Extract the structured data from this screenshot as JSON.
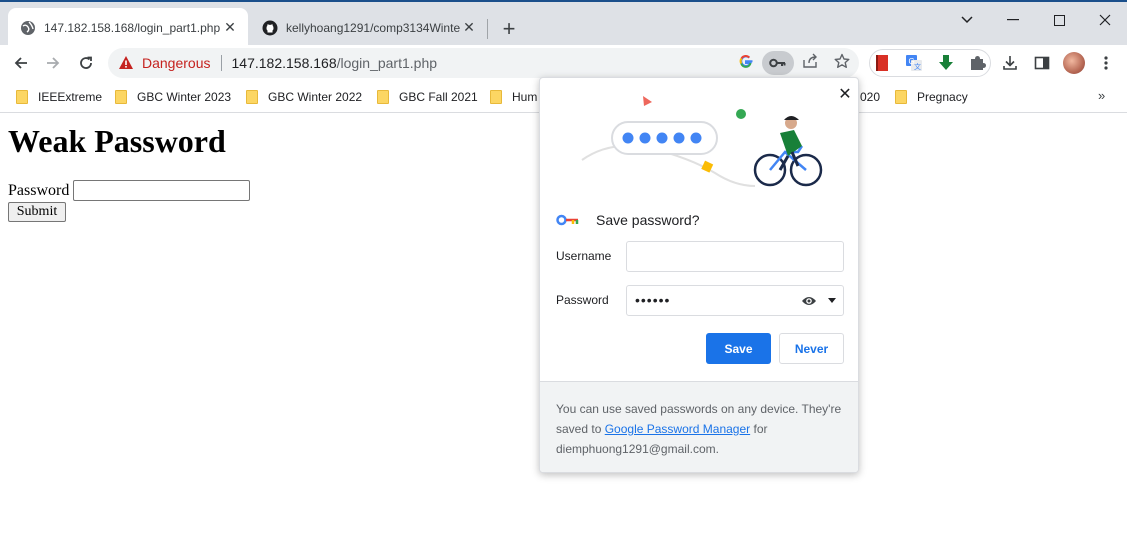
{
  "tabs": [
    {
      "title": "147.182.158.168/login_part1.php",
      "active": true
    },
    {
      "title": "kellyhoang1291/comp3134Winte",
      "active": false
    }
  ],
  "omnibox": {
    "security_label": "Dangerous",
    "url_host": "147.182.158.168",
    "url_path": "/login_part1.php"
  },
  "bookmarks": [
    {
      "label": "IEEExtreme"
    },
    {
      "label": "GBC Winter 2023"
    },
    {
      "label": "GBC Winter 2022"
    },
    {
      "label": "GBC Fall 2021"
    },
    {
      "label": "Hum"
    },
    {
      "label": "020"
    },
    {
      "label": "Pregnacy"
    }
  ],
  "page": {
    "heading": "Weak Password",
    "password_label": "Password",
    "submit_label": "Submit"
  },
  "save_dialog": {
    "title": "Save password?",
    "username_label": "Username",
    "username_value": "",
    "password_label": "Password",
    "password_value": "••••••",
    "save_label": "Save",
    "never_label": "Never",
    "footer_text_1": "You can use saved passwords on any device. They're saved to",
    "footer_link": "Google Password Manager",
    "footer_text_2": "for",
    "footer_email": "diemphuong1291@gmail.com."
  },
  "colors": {
    "accent": "#1a73e8",
    "danger": "#c5221f",
    "tabstrip": "#dee1e6"
  }
}
